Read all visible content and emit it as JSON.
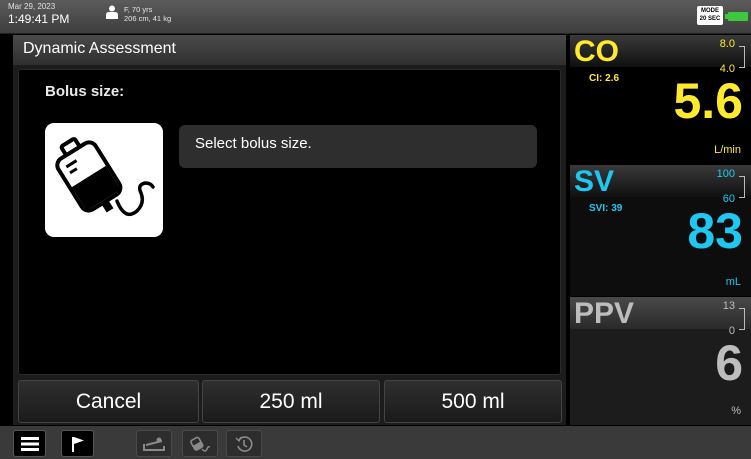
{
  "status": {
    "date": "Mar 29, 2023",
    "time": "1:49:41 PM",
    "patient_line1": "F, 70 yrs",
    "patient_line2": "206 cm, 41 kg",
    "mode_line1": "MODE",
    "mode_line2": "20 SEC",
    "battery_color": "#3ec83e"
  },
  "panel": {
    "title": "Dynamic Assessment",
    "bolus_label": "Bolus size:",
    "bag_icon": "iv-bag-icon",
    "prompt": "Select bolus size.",
    "buttons": {
      "cancel": "Cancel",
      "opt1": "250 ml",
      "opt2": "500 ml"
    }
  },
  "parameters": {
    "co": {
      "name": "CO",
      "sub": "CI: 2.6",
      "high": "8.0",
      "low": "4.0",
      "value": "5.6",
      "unit": "L/min",
      "color": "#ffea2b"
    },
    "sv": {
      "name": "SV",
      "sub": "SVI: 39",
      "high": "100",
      "low": "60",
      "value": "83",
      "unit": "mL",
      "color": "#1ec8f2"
    },
    "ppv": {
      "name": "PPV",
      "high": "13",
      "low": "0",
      "value": "6",
      "unit": "%",
      "color": "#bdbdbd"
    }
  },
  "toolbar": {
    "icons": [
      "menu-icon",
      "flag-icon",
      "bed-icon",
      "iv-bag-icon",
      "history-icon"
    ]
  }
}
